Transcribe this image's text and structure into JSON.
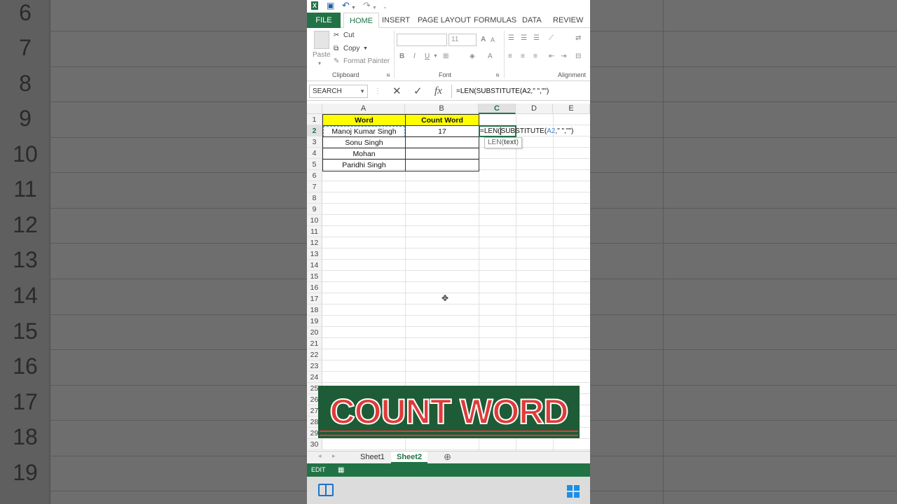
{
  "backdrop": {
    "left_rows": [
      "6",
      "7",
      "8",
      "9",
      "10",
      "11",
      "12",
      "13",
      "14",
      "15",
      "16",
      "17",
      "18",
      "19"
    ]
  },
  "qat": {
    "undo": "↶",
    "redo": "↷"
  },
  "ribbon_tabs": [
    "FILE",
    "HOME",
    "INSERT",
    "PAGE LAYOUT",
    "FORMULAS",
    "DATA",
    "REVIEW"
  ],
  "clipboard": {
    "paste": "Paste",
    "cut": "Cut",
    "copy": "Copy",
    "format_painter": "Format Painter",
    "label": "Clipboard"
  },
  "font": {
    "size": "11",
    "bold": "B",
    "italic": "I",
    "underline": "U",
    "grow": "A",
    "label": "Font"
  },
  "alignment": {
    "label": "Alignment"
  },
  "formula_bar": {
    "name_box": "SEARCH",
    "cancel": "✕",
    "enter": "✓",
    "fx": "fx",
    "formula": "=LEN(SUBSTITUTE(A2,\" \",\"\")"
  },
  "columns": [
    "A",
    "B",
    "C",
    "D",
    "E"
  ],
  "rows": [
    "1",
    "2",
    "3",
    "4",
    "5",
    "6",
    "7",
    "8",
    "9",
    "10",
    "11",
    "12",
    "13",
    "14",
    "15",
    "16",
    "17",
    "18",
    "19",
    "20",
    "21",
    "22",
    "23",
    "24",
    "25",
    "26",
    "27",
    "28",
    "29",
    "30"
  ],
  "table": {
    "header_a": "Word",
    "header_b": "Count Word",
    "words": [
      "Manoj Kumar Singh",
      "Sonu Singh",
      "Mohan",
      "Paridhi Singh"
    ],
    "b2": "17",
    "c2_prefix": "=LEN(",
    "c2_func": "SUBSTITUTE(",
    "c2_ref": "A2",
    "c2_rest": ",\" \",\"\")"
  },
  "tooltip": {
    "fn": "LEN(",
    "arg": "text",
    "close": ")"
  },
  "banner": {
    "text": "COUNT WORD"
  },
  "sheets": [
    "Sheet1",
    "Sheet2"
  ],
  "status": {
    "mode": "EDIT"
  },
  "colors": {
    "excel_green": "#217346",
    "header_yellow": "#ffff00",
    "banner_red": "#e03a3a",
    "banner_bg": "#1d5c36"
  }
}
